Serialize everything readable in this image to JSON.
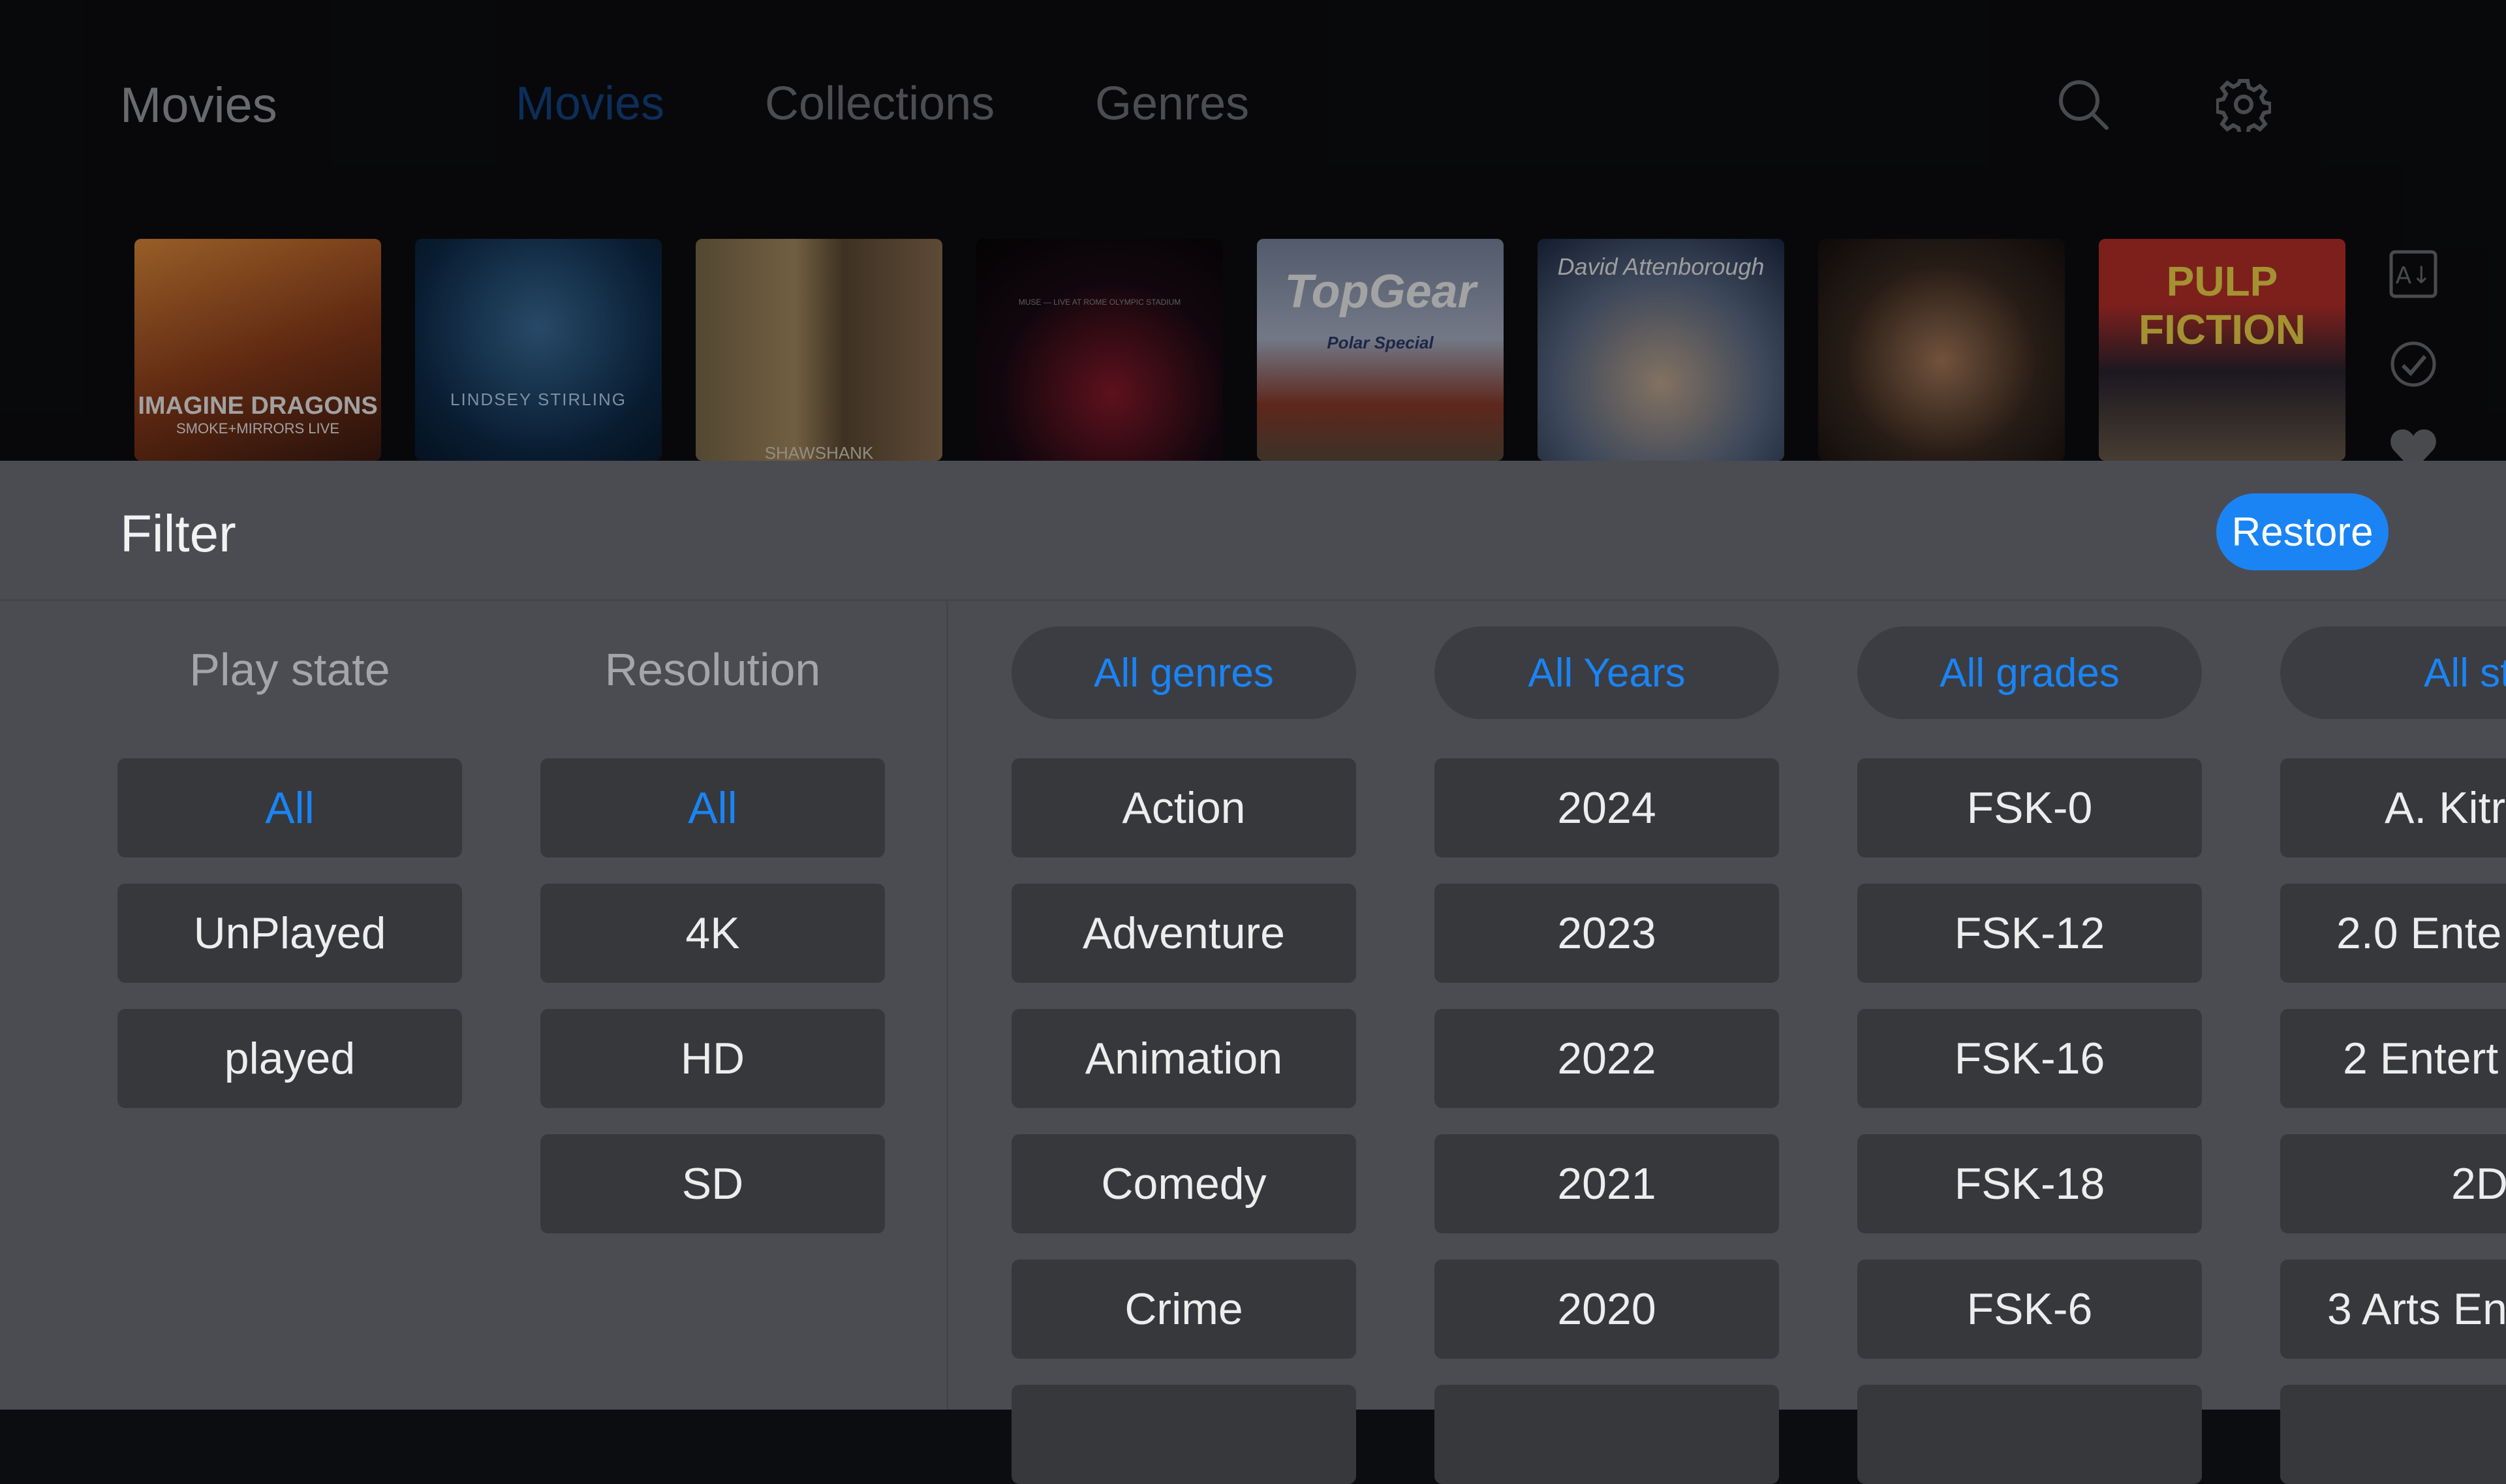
{
  "header": {
    "app_title": "Movies",
    "tabs": [
      "Movies",
      "Collections",
      "Genres"
    ],
    "active_tab": "Movies"
  },
  "posters": [
    {
      "caption": "IMAGINE DRAGONS",
      "subcaption": "SMOKE+MIRRORS LIVE"
    },
    {
      "caption": "LINDSEY STIRLING"
    },
    {
      "caption": "SHAWSHANK"
    },
    {
      "caption": "MUSE — LIVE AT ROME OLYMPIC STADIUM"
    },
    {
      "caption": "TopGear",
      "subcaption": "Polar Special"
    },
    {
      "caption": "David Attenborough"
    },
    {
      "caption": ""
    },
    {
      "caption": "PULP FICTION"
    }
  ],
  "filter": {
    "title": "Filter",
    "restore_label": "Restore",
    "play_state": {
      "header": "Play state",
      "options": [
        "All",
        "UnPlayed",
        "played"
      ],
      "selected": "All"
    },
    "resolution": {
      "header": "Resolution",
      "options": [
        "All",
        "4K",
        "HD",
        "SD"
      ],
      "selected": "All"
    },
    "genres": {
      "header": "All genres",
      "options": [
        "Action",
        "Adventure",
        "Animation",
        "Comedy",
        "Crime"
      ]
    },
    "years": {
      "header": "All Years",
      "options": [
        "2024",
        "2023",
        "2022",
        "2021",
        "2020"
      ]
    },
    "grades": {
      "header": "All grades",
      "options": [
        "FSK-0",
        "FSK-12",
        "FSK-16",
        "FSK-18",
        "FSK-6"
      ]
    },
    "studios": {
      "header": "All st",
      "options": [
        "A. Kitr",
        "2.0 Ente",
        "2 Entert",
        "2D",
        "3 Arts En"
      ]
    }
  },
  "colors": {
    "accent": "#1a84f5",
    "panel": "#4a4c52",
    "button": "#36383c"
  }
}
